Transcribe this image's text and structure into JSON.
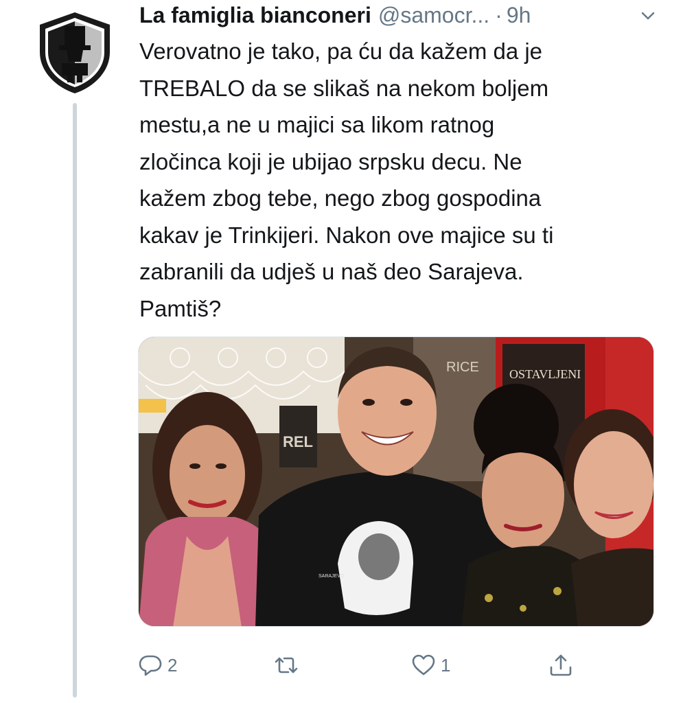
{
  "tweet": {
    "display_name": "La famiglia bianconeri",
    "handle": "@samocr...",
    "separator": "·",
    "time": "9h",
    "text_lines": [
      "Verovatno je tako, pa ću da kažem da je",
      "TREBALO da se slikaš na nekom boljem",
      "mestu,a ne u majici sa likom ratnog",
      "zločinca koji je ubijao srpsku decu. Ne",
      "kažem zbog tebe, nego zbog gospodina",
      "kakav je Trinkijeri. Nakon ove majice su ti",
      "zabranili da udješ u naš deo Sarajeva.",
      "Pamtiš?"
    ],
    "media": {
      "poster_text": "OSTAVLJENI",
      "sign_text_1": "RICE",
      "sign_text_2": "REL",
      "shirt_text": "SARAJEVO"
    }
  },
  "actions": {
    "reply_count": "2",
    "retweet_count": "",
    "like_count": "1"
  },
  "icons": {
    "avatar": "club-logo-icon",
    "caret": "chevron-down-icon",
    "reply": "reply-icon",
    "retweet": "retweet-icon",
    "like": "heart-icon",
    "share": "share-icon"
  },
  "colors": {
    "text": "#14171a",
    "secondary": "#657786",
    "thread_line": "#ccd6dd"
  }
}
